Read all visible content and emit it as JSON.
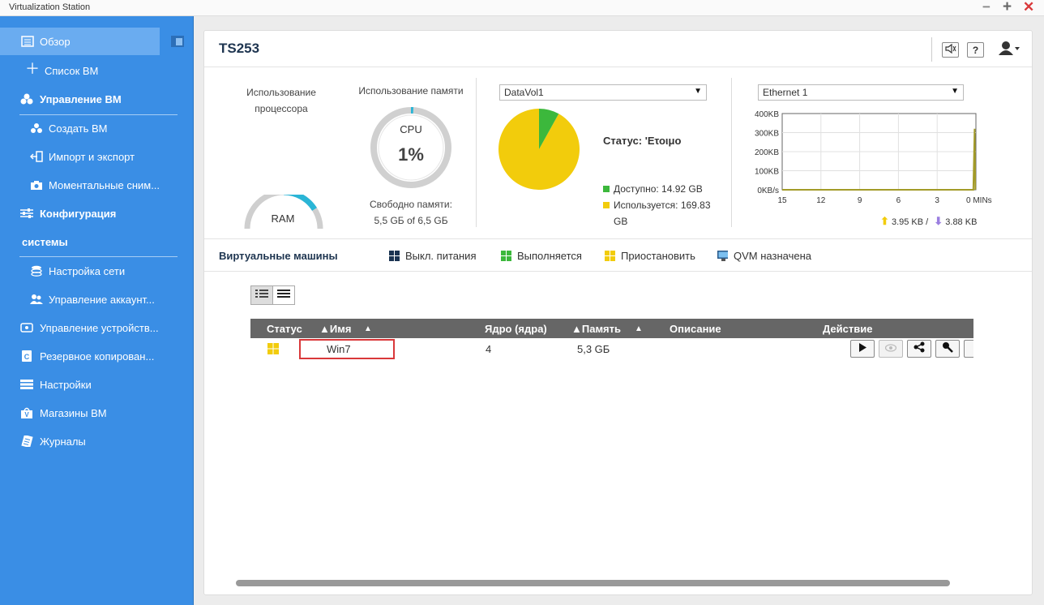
{
  "window": {
    "title": "Virtualization Station",
    "controls": {
      "minimize": "−",
      "maximize": "+",
      "close": "✕"
    }
  },
  "sidebar": {
    "items": [
      {
        "label": "Обзор",
        "icon": "overview-icon",
        "active": true
      },
      {
        "label": "Список ВМ",
        "icon": "plus-icon"
      },
      {
        "label": "Управление ВМ",
        "icon": "vm-management-icon",
        "section": true
      },
      {
        "label": "Создать ВМ",
        "icon": "create-vm-icon"
      },
      {
        "label": "Импорт и экспорт",
        "icon": "import-export-icon"
      },
      {
        "label": "Моментальные сним...",
        "icon": "snapshot-camera-icon"
      },
      {
        "label": "Конфигурация",
        "icon": "configuration-icon",
        "section": true
      },
      {
        "label": "системы",
        "section": true
      },
      {
        "label": "Настройка сети",
        "icon": "network-icon"
      },
      {
        "label": "Управление аккаунт...",
        "icon": "accounts-icon"
      },
      {
        "label": "Управление устройств...",
        "icon": "device-icon"
      },
      {
        "label": "Резервное копирован...",
        "icon": "backup-icon"
      },
      {
        "label": "Настройки",
        "icon": "settings-icon"
      },
      {
        "label": "Магазины ВМ",
        "icon": "store-icon"
      },
      {
        "label": "Журналы",
        "icon": "logs-icon"
      }
    ]
  },
  "header": {
    "hostname": "TS253",
    "buttons": {
      "volume_icon": "speaker-icon",
      "help": "?",
      "user_icon": "user-icon"
    }
  },
  "cpu": {
    "label_line1": "Использование",
    "label_line2": "процессора",
    "gauge_label": "RAM"
  },
  "memory": {
    "label": "Использование памяти",
    "gauge_label": "CPU",
    "value": "1%",
    "value_fraction": 0.01,
    "free_label": "Свободно памяти:",
    "free_value": "5,5 GБ of 6,5 GБ"
  },
  "storage": {
    "volume": "DataVol1",
    "status": "Статус: 'Ετοιμο",
    "available": "Доступно: 14.92 GB",
    "used_line1": "Используется: 169.83",
    "used_line2": "GB",
    "pie": {
      "available_gb": 14.92,
      "used_gb": 169.83
    },
    "colors": {
      "available": "#3cb83c",
      "used": "#f2cc0c"
    }
  },
  "network": {
    "interface": "Ethernet 1",
    "up_rate": "3.95 KB /",
    "down_rate": "3.88 KB"
  },
  "chart_data": {
    "type": "line",
    "y_tick_labels": [
      "400KB",
      "300KB",
      "200KB",
      "100KB",
      "0KB/s"
    ],
    "x_tick_labels": [
      "15",
      "12",
      "9",
      "6",
      "3",
      "0 MINs"
    ],
    "ylim": [
      0,
      400
    ],
    "xlim": [
      15,
      0
    ],
    "grid": true,
    "series": [
      {
        "values": [
          [
            15,
            0
          ],
          [
            0.2,
            0
          ],
          [
            0.1,
            320
          ],
          [
            0.05,
            0
          ]
        ],
        "color": "#a39b28"
      }
    ]
  },
  "vm_bar": {
    "title": "Виртуальные машины",
    "legend": [
      {
        "label": "Выкл. питания",
        "color": "#1a3352"
      },
      {
        "label": "Выполняется",
        "color": "#3cb83c"
      },
      {
        "label": "Приостановить",
        "color": "#f2cc0c"
      },
      {
        "label": "QVM назначена",
        "icon": "monitor-icon"
      }
    ]
  },
  "table": {
    "view_toggle": [
      "detail-list-view-icon",
      "list-view-icon"
    ],
    "columns": [
      "Статус",
      "▲Имя",
      "▲",
      "Ядро (ядра)",
      "▲Память",
      "▲",
      "Описание",
      "Действие"
    ],
    "rows": [
      {
        "status_color": "#f2cc0c",
        "name": "Win7",
        "cores": "4",
        "memory": "5,3 GБ",
        "description": ""
      }
    ],
    "actions": [
      "play-icon",
      "view-icon",
      "share-icon",
      "settings-wrench-icon"
    ]
  },
  "colors": {
    "sidebar_bg": "#3a8ee5",
    "sidebar_active": "#6aacf0",
    "accent_teal": "#2ab5d6",
    "highlight_red": "#d9383a"
  }
}
